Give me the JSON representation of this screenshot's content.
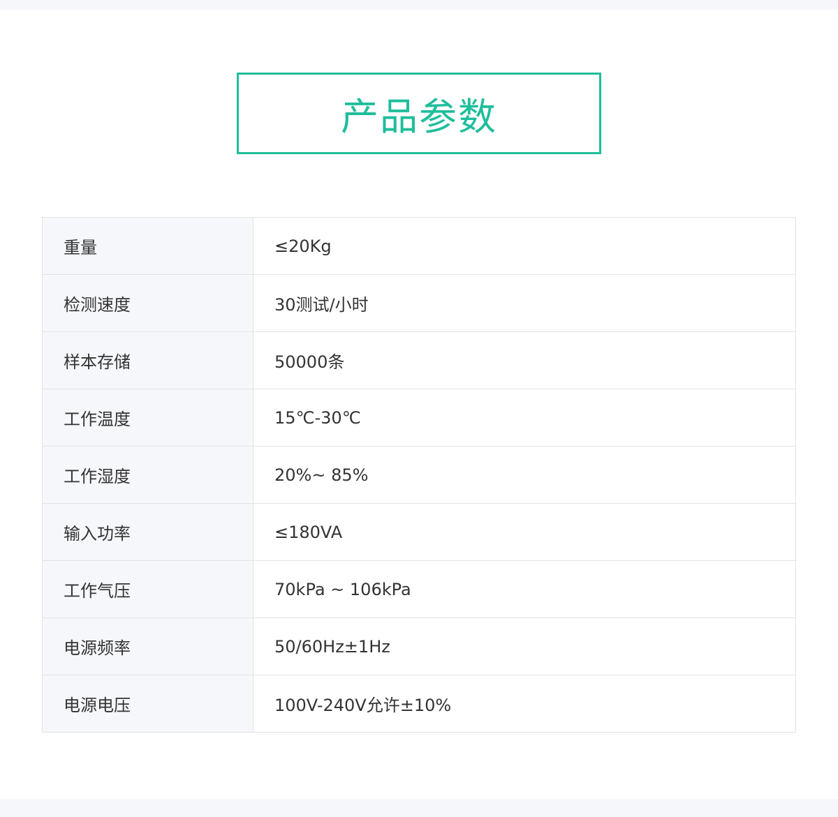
{
  "title": "产品参数",
  "params": [
    {
      "label": "重量",
      "value": "≤20Kg"
    },
    {
      "label": "检测速度",
      "value": "30测试/小时"
    },
    {
      "label": "样本存储",
      "value": "50000条"
    },
    {
      "label": "工作温度",
      "value": "15℃-30℃"
    },
    {
      "label": "工作湿度",
      "value": "20%~ 85%"
    },
    {
      "label": "输入功率",
      "value": "≤180VA"
    },
    {
      "label": "工作气压",
      "value": "70kPa ~ 106kPa"
    },
    {
      "label": "电源频率",
      "value": "50/60Hz±1Hz"
    },
    {
      "label": "电源电压",
      "value": "100V-240V允许±10%"
    }
  ],
  "colors": {
    "accent": "#1ebe9b",
    "label_bg": "#f6f7fa",
    "border": "#e3e3e3",
    "text": "#333333"
  }
}
